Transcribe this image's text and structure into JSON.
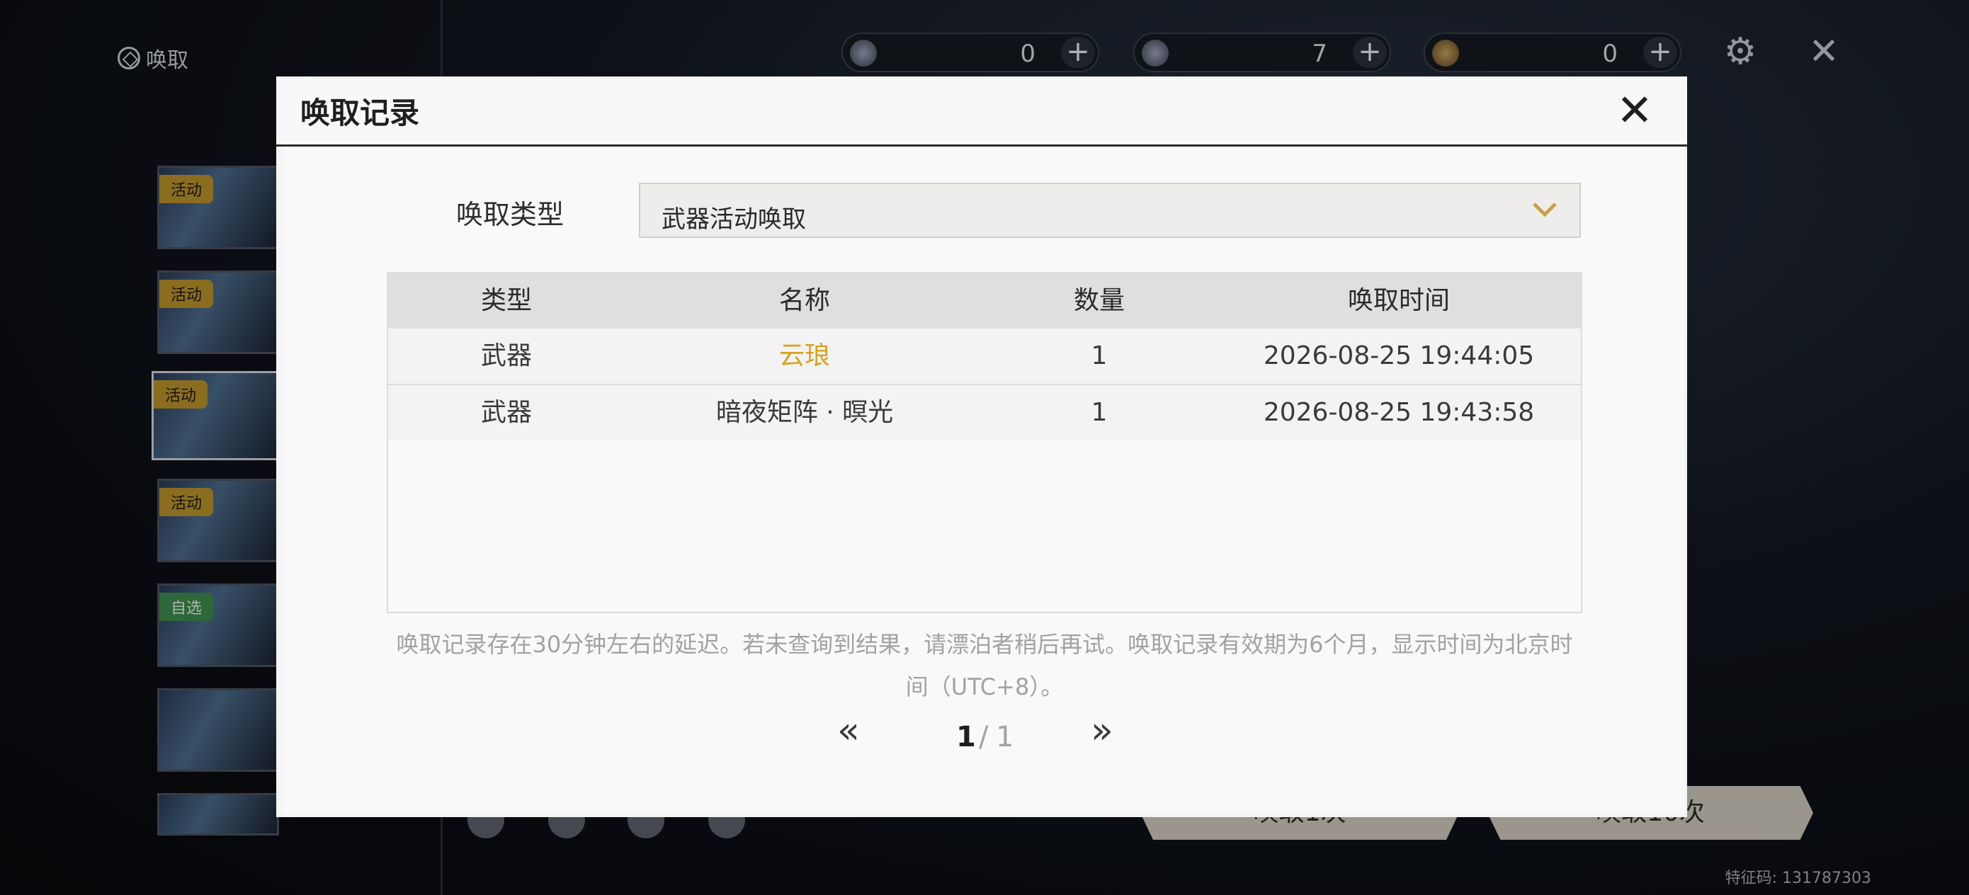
{
  "screen": {
    "title": "唤取",
    "feature_code": "特征码: 131787303"
  },
  "banners": [
    {
      "tag": "活动",
      "tag_color": "#b8922a"
    },
    {
      "tag": "活动",
      "tag_color": "#b8922a"
    },
    {
      "tag": "活动",
      "tag_color": "#b8922a"
    },
    {
      "tag": "活动",
      "tag_color": "#b8922a"
    },
    {
      "tag": "自选",
      "tag_color": "#3e8a4e"
    },
    {
      "tag": ""
    },
    {
      "tag": ""
    }
  ],
  "currencies": [
    {
      "icon": "astrite-icon",
      "value": "0"
    },
    {
      "icon": "lustrous-tide-icon",
      "value": "7"
    },
    {
      "icon": "forging-tide-icon",
      "value": "0"
    }
  ],
  "bottom_buttons": {
    "pull_once": "唤取1次",
    "pull_ten": "唤取10次"
  },
  "modal": {
    "title": "唤取记录",
    "type_label": "唤取类型",
    "selected_type": "武器活动唤取",
    "columns": [
      "类型",
      "名称",
      "数量",
      "唤取时间"
    ],
    "rows": [
      {
        "type": "武器",
        "name": "云琅",
        "count": "1",
        "time": "2026-08-25 19:44:05",
        "name_color": "#d9a21f"
      },
      {
        "type": "武器",
        "name": "暗夜矩阵 · 暝光",
        "count": "1",
        "time": "2026-08-25 19:43:58"
      }
    ],
    "note": "唤取记录存在30分钟左右的延迟。若未查询到结果，请漂泊者稍后再试。唤取记录有效期为6个月，显示时间为北京时间（UTC+8）。",
    "pager": {
      "current": "1",
      "separator": "/",
      "total": "1",
      "prev": "«",
      "next": "»"
    }
  }
}
